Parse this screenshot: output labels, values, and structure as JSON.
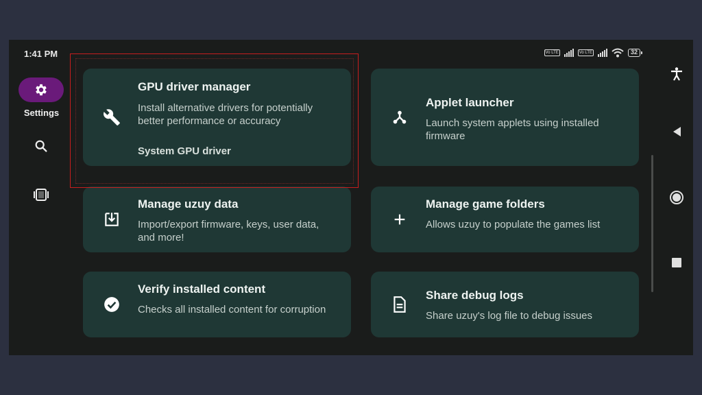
{
  "status_bar": {
    "time": "1:41 PM",
    "volte_label": "Vo LTE",
    "battery": "32"
  },
  "rail": {
    "settings_label": "Settings"
  },
  "cards": [
    {
      "title": "GPU driver manager",
      "description": "Install alternative drivers for potentially better performance or accuracy",
      "subtitle": "System GPU driver"
    },
    {
      "title": "Applet launcher",
      "description": "Launch system applets using installed firmware"
    },
    {
      "title": "Manage uzuy data",
      "description": "Import/export firmware, keys, user data, and more!"
    },
    {
      "title": "Manage game folders",
      "description": "Allows uzuy to populate the games list"
    },
    {
      "title": "Verify installed content",
      "description": "Checks all installed content for corruption"
    },
    {
      "title": "Share debug logs",
      "description": "Share uzuy's log file to debug issues"
    }
  ],
  "colors": {
    "background": "#2c3040",
    "screen": "#1a1c1b",
    "card": "#1f3835",
    "rail_selected": "#6a1a7a",
    "highlight": "#c81e1e"
  },
  "icons": [
    "gear-icon",
    "search-icon",
    "games-icon",
    "wrench-icon",
    "applet-icon",
    "download-icon",
    "plus-icon",
    "check-circle-icon",
    "document-icon",
    "accessibility-icon",
    "back-icon",
    "home-icon",
    "recents-icon"
  ]
}
